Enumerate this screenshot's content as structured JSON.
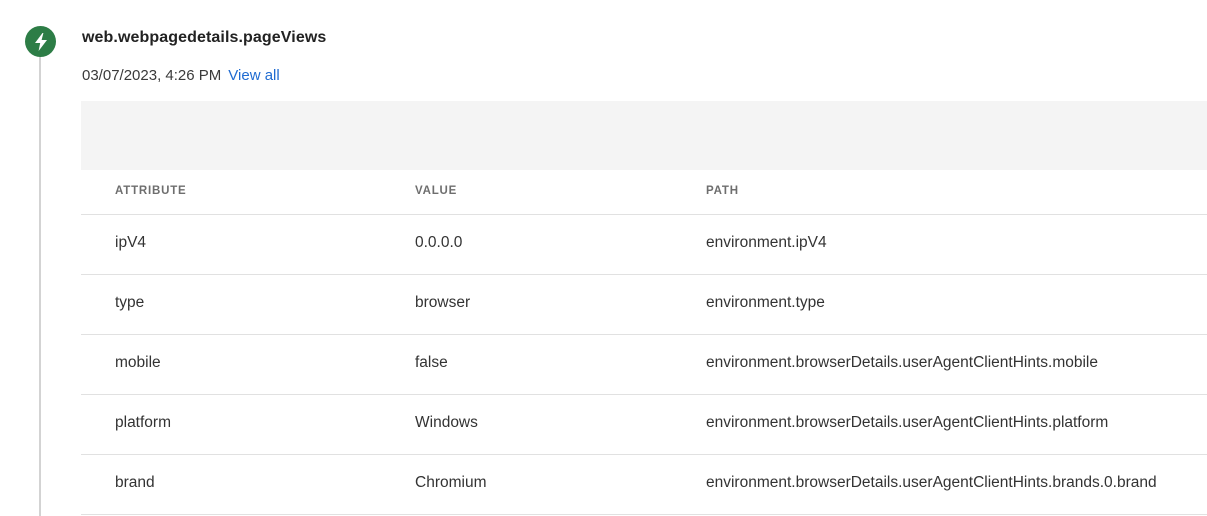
{
  "event": {
    "title": "web.webpagedetails.pageViews",
    "timestamp": "03/07/2023, 4:26 PM",
    "view_all_label": "View all",
    "icon": "lightning-bolt-icon",
    "icon_color": "#2d7d46"
  },
  "table": {
    "columns": [
      "ATTRIBUTE",
      "VALUE",
      "PATH"
    ],
    "rows": [
      {
        "attribute": "ipV4",
        "value": "0.0.0.0",
        "path": "environment.ipV4"
      },
      {
        "attribute": "type",
        "value": "browser",
        "path": "environment.type"
      },
      {
        "attribute": "mobile",
        "value": "false",
        "path": "environment.browserDetails.userAgentClientHints.mobile"
      },
      {
        "attribute": "platform",
        "value": "Windows",
        "path": "environment.browserDetails.userAgentClientHints.platform"
      },
      {
        "attribute": "brand",
        "value": "Chromium",
        "path": "environment.browserDetails.userAgentClientHints.brands.0.brand"
      }
    ]
  },
  "colors": {
    "link": "#1f6bd1",
    "panel_bg": "#f4f4f4",
    "divider": "#e1e1e1"
  }
}
